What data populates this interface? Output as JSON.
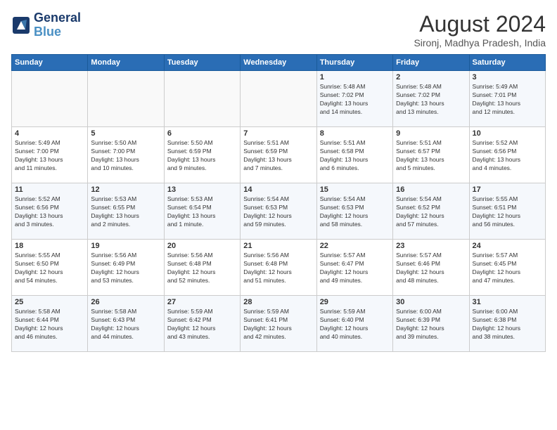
{
  "header": {
    "logo_line1": "General",
    "logo_line2": "Blue",
    "month_year": "August 2024",
    "location": "Sironj, Madhya Pradesh, India"
  },
  "days_of_week": [
    "Sunday",
    "Monday",
    "Tuesday",
    "Wednesday",
    "Thursday",
    "Friday",
    "Saturday"
  ],
  "weeks": [
    [
      {
        "day": "",
        "detail": ""
      },
      {
        "day": "",
        "detail": ""
      },
      {
        "day": "",
        "detail": ""
      },
      {
        "day": "",
        "detail": ""
      },
      {
        "day": "1",
        "detail": "Sunrise: 5:48 AM\nSunset: 7:02 PM\nDaylight: 13 hours\nand 14 minutes."
      },
      {
        "day": "2",
        "detail": "Sunrise: 5:48 AM\nSunset: 7:02 PM\nDaylight: 13 hours\nand 13 minutes."
      },
      {
        "day": "3",
        "detail": "Sunrise: 5:49 AM\nSunset: 7:01 PM\nDaylight: 13 hours\nand 12 minutes."
      }
    ],
    [
      {
        "day": "4",
        "detail": "Sunrise: 5:49 AM\nSunset: 7:00 PM\nDaylight: 13 hours\nand 11 minutes."
      },
      {
        "day": "5",
        "detail": "Sunrise: 5:50 AM\nSunset: 7:00 PM\nDaylight: 13 hours\nand 10 minutes."
      },
      {
        "day": "6",
        "detail": "Sunrise: 5:50 AM\nSunset: 6:59 PM\nDaylight: 13 hours\nand 9 minutes."
      },
      {
        "day": "7",
        "detail": "Sunrise: 5:51 AM\nSunset: 6:59 PM\nDaylight: 13 hours\nand 7 minutes."
      },
      {
        "day": "8",
        "detail": "Sunrise: 5:51 AM\nSunset: 6:58 PM\nDaylight: 13 hours\nand 6 minutes."
      },
      {
        "day": "9",
        "detail": "Sunrise: 5:51 AM\nSunset: 6:57 PM\nDaylight: 13 hours\nand 5 minutes."
      },
      {
        "day": "10",
        "detail": "Sunrise: 5:52 AM\nSunset: 6:56 PM\nDaylight: 13 hours\nand 4 minutes."
      }
    ],
    [
      {
        "day": "11",
        "detail": "Sunrise: 5:52 AM\nSunset: 6:56 PM\nDaylight: 13 hours\nand 3 minutes."
      },
      {
        "day": "12",
        "detail": "Sunrise: 5:53 AM\nSunset: 6:55 PM\nDaylight: 13 hours\nand 2 minutes."
      },
      {
        "day": "13",
        "detail": "Sunrise: 5:53 AM\nSunset: 6:54 PM\nDaylight: 13 hours\nand 1 minute."
      },
      {
        "day": "14",
        "detail": "Sunrise: 5:54 AM\nSunset: 6:53 PM\nDaylight: 12 hours\nand 59 minutes."
      },
      {
        "day": "15",
        "detail": "Sunrise: 5:54 AM\nSunset: 6:53 PM\nDaylight: 12 hours\nand 58 minutes."
      },
      {
        "day": "16",
        "detail": "Sunrise: 5:54 AM\nSunset: 6:52 PM\nDaylight: 12 hours\nand 57 minutes."
      },
      {
        "day": "17",
        "detail": "Sunrise: 5:55 AM\nSunset: 6:51 PM\nDaylight: 12 hours\nand 56 minutes."
      }
    ],
    [
      {
        "day": "18",
        "detail": "Sunrise: 5:55 AM\nSunset: 6:50 PM\nDaylight: 12 hours\nand 54 minutes."
      },
      {
        "day": "19",
        "detail": "Sunrise: 5:56 AM\nSunset: 6:49 PM\nDaylight: 12 hours\nand 53 minutes."
      },
      {
        "day": "20",
        "detail": "Sunrise: 5:56 AM\nSunset: 6:48 PM\nDaylight: 12 hours\nand 52 minutes."
      },
      {
        "day": "21",
        "detail": "Sunrise: 5:56 AM\nSunset: 6:48 PM\nDaylight: 12 hours\nand 51 minutes."
      },
      {
        "day": "22",
        "detail": "Sunrise: 5:57 AM\nSunset: 6:47 PM\nDaylight: 12 hours\nand 49 minutes."
      },
      {
        "day": "23",
        "detail": "Sunrise: 5:57 AM\nSunset: 6:46 PM\nDaylight: 12 hours\nand 48 minutes."
      },
      {
        "day": "24",
        "detail": "Sunrise: 5:57 AM\nSunset: 6:45 PM\nDaylight: 12 hours\nand 47 minutes."
      }
    ],
    [
      {
        "day": "25",
        "detail": "Sunrise: 5:58 AM\nSunset: 6:44 PM\nDaylight: 12 hours\nand 46 minutes."
      },
      {
        "day": "26",
        "detail": "Sunrise: 5:58 AM\nSunset: 6:43 PM\nDaylight: 12 hours\nand 44 minutes."
      },
      {
        "day": "27",
        "detail": "Sunrise: 5:59 AM\nSunset: 6:42 PM\nDaylight: 12 hours\nand 43 minutes."
      },
      {
        "day": "28",
        "detail": "Sunrise: 5:59 AM\nSunset: 6:41 PM\nDaylight: 12 hours\nand 42 minutes."
      },
      {
        "day": "29",
        "detail": "Sunrise: 5:59 AM\nSunset: 6:40 PM\nDaylight: 12 hours\nand 40 minutes."
      },
      {
        "day": "30",
        "detail": "Sunrise: 6:00 AM\nSunset: 6:39 PM\nDaylight: 12 hours\nand 39 minutes."
      },
      {
        "day": "31",
        "detail": "Sunrise: 6:00 AM\nSunset: 6:38 PM\nDaylight: 12 hours\nand 38 minutes."
      }
    ]
  ]
}
